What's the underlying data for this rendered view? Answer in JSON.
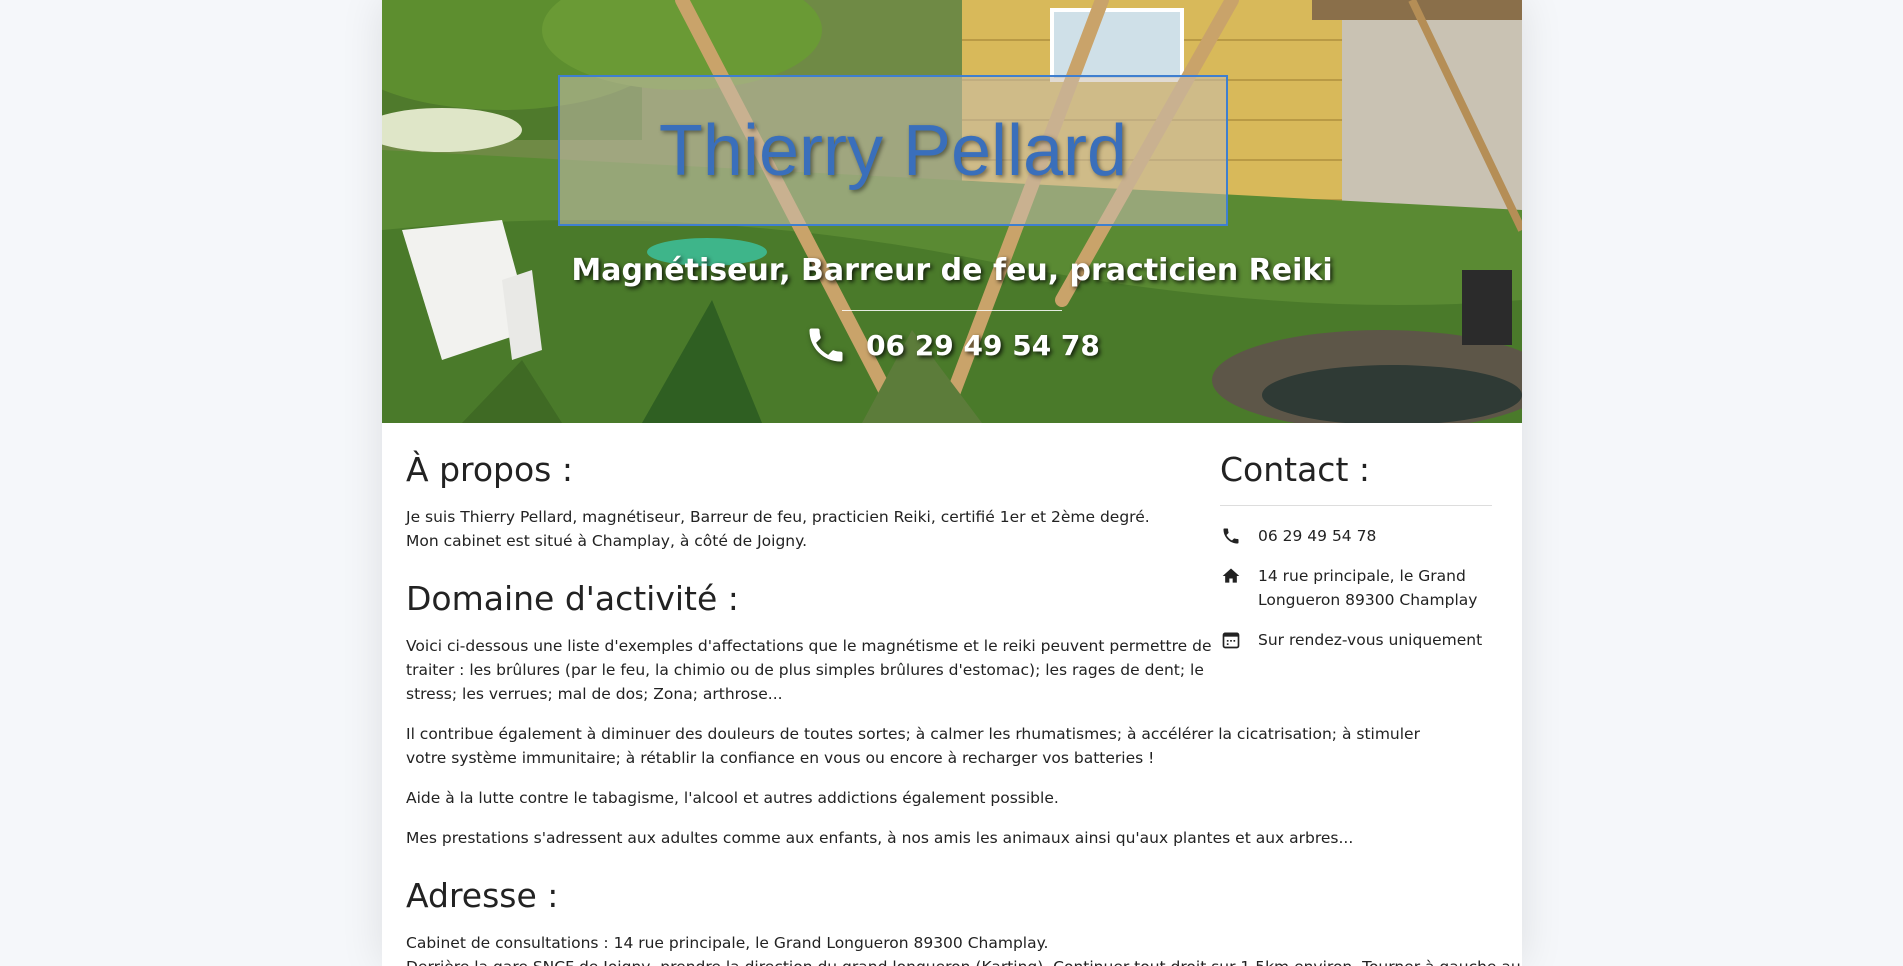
{
  "hero": {
    "title": "Thierry Pellard",
    "subtitle": "Magnétiseur, Barreur de feu, practicien Reiki",
    "phone": "06 29 49 54 78"
  },
  "about": {
    "heading": "À propos :",
    "lines": [
      "Je suis Thierry Pellard, magnétiseur, Barreur de feu, practicien Reiki, certifié 1er et 2ème degré.",
      "Mon cabinet est situé à Champlay, à côté de Joigny."
    ]
  },
  "activity": {
    "heading": "Domaine d'activité :",
    "paragraphs": [
      "Voici ci-dessous une liste d'exemples d'affectations que le magnétisme et le reiki peuvent permettre de traiter : les brûlures (par le feu, la chimio ou de plus simples brûlures d'estomac); les rages de dent; le stress; les verrues; mal de dos; Zona; arthrose...",
      "Il contribue également à diminuer des douleurs de toutes sortes; à calmer les rhumatismes; à accélérer la cicatrisation; à stimuler votre système immunitaire; à rétablir la confiance en vous ou encore à recharger vos batteries !",
      "Aide à la lutte contre le tabagisme, l'alcool et autres addictions également possible.",
      "Mes prestations s'adressent aux adultes comme aux enfants, à nos amis les animaux ainsi qu'aux plantes et aux arbres..."
    ]
  },
  "address": {
    "heading": "Adresse :",
    "line1": "Cabinet de consultations : 14 rue principale, le Grand Longueron 89300 Champlay.",
    "line2": "Derrière la gare SNCF de Joigny, prendre la direction du grand longueron (Karting). Continuer tout droit sur 1,5km environ. Tourner à gauche au bout de la"
  },
  "contact": {
    "heading": "Contact :",
    "phone": "06 29 49 54 78",
    "address": "14 rue principale, le Grand Longueron 89300 Champlay",
    "hours": "Sur rendez-vous uniquement",
    "icons": [
      "phone-icon",
      "home-icon",
      "calendar-icon"
    ]
  },
  "colors": {
    "title_blue": "#3a6fbb",
    "title_border": "#3f7fd0",
    "page_bg": "#f5f7fa"
  }
}
